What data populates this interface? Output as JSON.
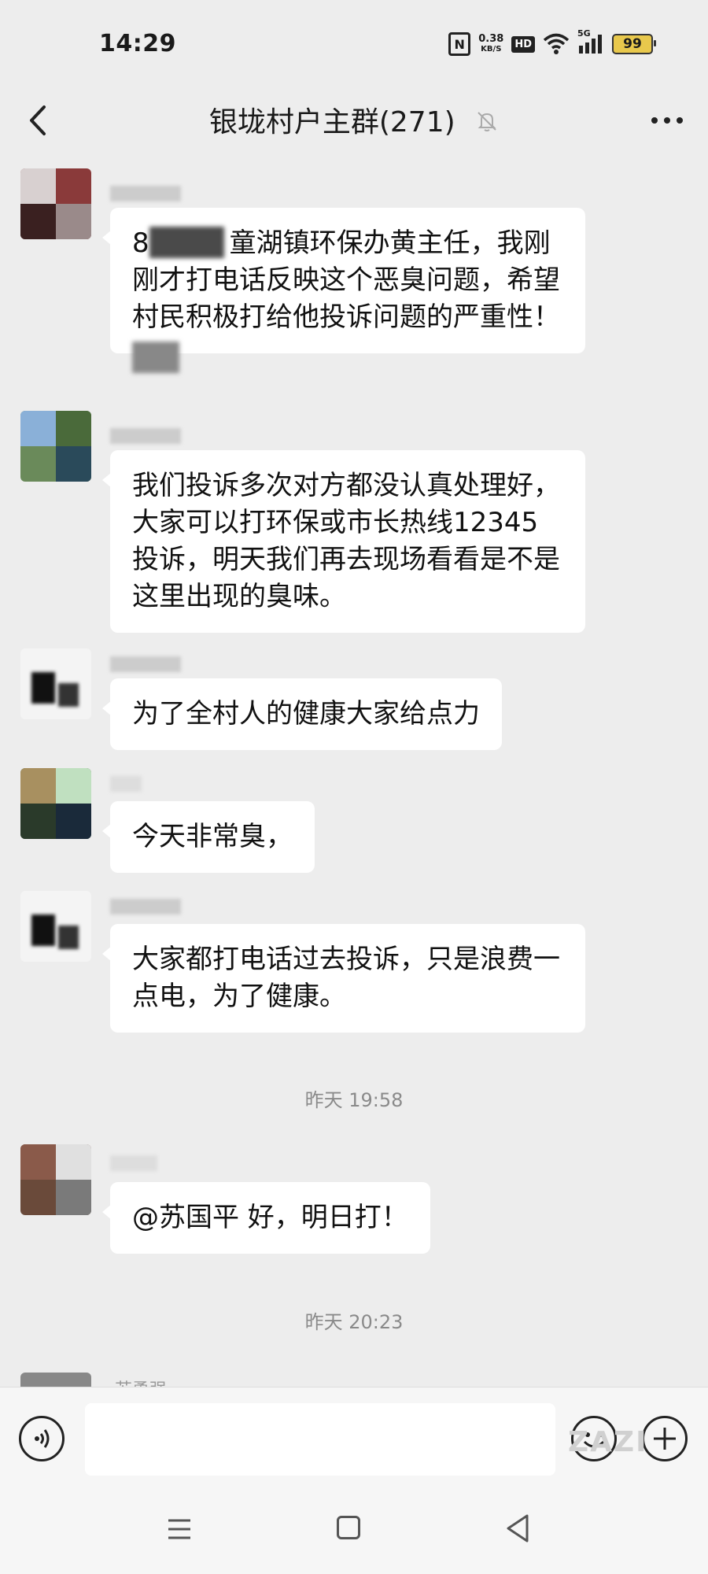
{
  "status_bar": {
    "time": "14:29",
    "net_speed_value": "0.38",
    "net_speed_unit": "KB/S",
    "hd_label": "HD",
    "network_label": "5G",
    "battery_level": "99"
  },
  "header": {
    "title": "银垅村户主群(271)"
  },
  "messages": [
    {
      "text": "8   童湖镇环保办黄主任，我刚刚才打电话反映这个恶臭问题，希望村民积极打给他投诉问题的严重性！"
    },
    {
      "text": "我们投诉多次对方都没认真处理好，大家可以打环保或市长热线12345 投诉，明天我们再去现场看看是不是这里出现的臭味。"
    },
    {
      "text": "为了全村人的健康大家给点力"
    },
    {
      "text": "今天非常臭，"
    },
    {
      "text": "大家都打电话过去投诉，只是浪费一点电，为了健康。"
    },
    {
      "text": "@苏国平  好，明日打！"
    }
  ],
  "timestamps": [
    "昨天 19:58",
    "昨天 20:23"
  ],
  "partial_sender": "苏勇强",
  "watermark": "ZAZI",
  "colors": {
    "background": "#ededed",
    "bubble": "#ffffff",
    "battery": "#e8c84c",
    "timestamp_text": "#8a8a8a"
  }
}
